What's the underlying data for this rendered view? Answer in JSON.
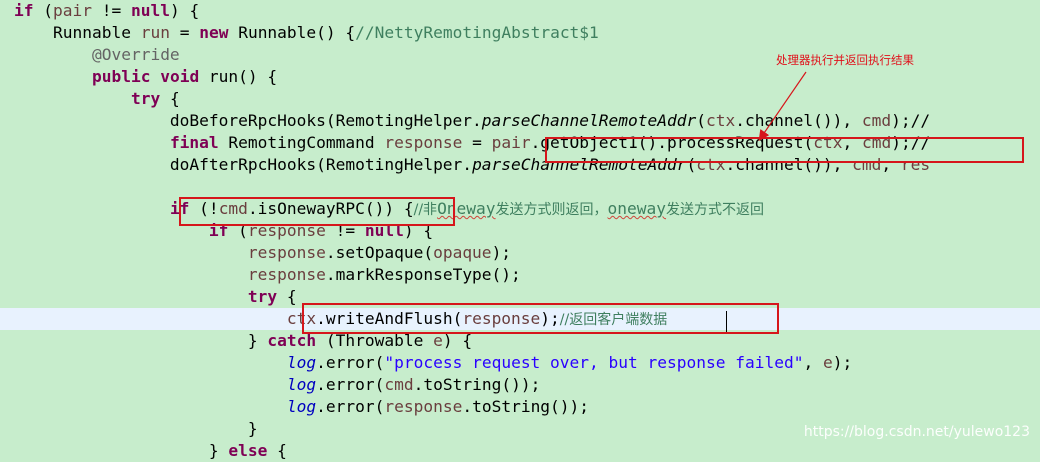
{
  "editor": {
    "lines": [
      {
        "segments": [
          {
            "t": "if",
            "c": "kw"
          },
          {
            "t": " ("
          },
          {
            "t": "pair",
            "c": "var"
          },
          {
            "t": " != "
          },
          {
            "t": "null",
            "c": "kw"
          },
          {
            "t": ") {"
          }
        ]
      },
      {
        "segments": [
          {
            "t": "    Runnable "
          },
          {
            "t": "run",
            "c": "var"
          },
          {
            "t": " = "
          },
          {
            "t": "new",
            "c": "kw"
          },
          {
            "t": " Runnable() {"
          },
          {
            "t": "//NettyRemotingAbstract$1",
            "c": "cm"
          }
        ]
      },
      {
        "segments": [
          {
            "t": "        "
          },
          {
            "t": "@Override",
            "c": "an"
          }
        ]
      },
      {
        "segments": [
          {
            "t": "        "
          },
          {
            "t": "public",
            "c": "kw"
          },
          {
            "t": " "
          },
          {
            "t": "void",
            "c": "kw"
          },
          {
            "t": " run() {"
          }
        ]
      },
      {
        "segments": [
          {
            "t": "            "
          },
          {
            "t": "try",
            "c": "kw"
          },
          {
            "t": " {"
          }
        ]
      },
      {
        "segments": [
          {
            "t": "                doBeforeRpcHooks(RemotingHelper."
          },
          {
            "t": "parseChannelRemoteAddr",
            "c": "it"
          },
          {
            "t": "("
          },
          {
            "t": "ctx",
            "c": "var"
          },
          {
            "t": ".channel()), "
          },
          {
            "t": "cmd",
            "c": "var"
          },
          {
            "t": ");//"
          }
        ]
      },
      {
        "segments": [
          {
            "t": "                "
          },
          {
            "t": "final",
            "c": "kw"
          },
          {
            "t": " RemotingCommand "
          },
          {
            "t": "response",
            "c": "var"
          },
          {
            "t": " = "
          },
          {
            "t": "pair",
            "c": "var"
          },
          {
            "t": ".getObject1().processRequest("
          },
          {
            "t": "ctx",
            "c": "var"
          },
          {
            "t": ", "
          },
          {
            "t": "cmd",
            "c": "var"
          },
          {
            "t": ");//"
          }
        ]
      },
      {
        "segments": [
          {
            "t": "                doAfterRpcHooks(RemotingHelper."
          },
          {
            "t": "parseChannelRemoteAddr",
            "c": "it"
          },
          {
            "t": "("
          },
          {
            "t": "ctx",
            "c": "var"
          },
          {
            "t": ".channel()), "
          },
          {
            "t": "cmd",
            "c": "var"
          },
          {
            "t": ", "
          },
          {
            "t": "res",
            "c": "var"
          }
        ]
      },
      {
        "segments": [
          {
            "t": ""
          }
        ]
      },
      {
        "segments": [
          {
            "t": "                "
          },
          {
            "t": "if",
            "c": "kw"
          },
          {
            "t": " (!"
          },
          {
            "t": "cmd",
            "c": "var"
          },
          {
            "t": ".isOnewayRPC()) {"
          },
          {
            "t": "//非",
            "c": "cm"
          },
          {
            "t": "Oneway",
            "c": "cm sq"
          },
          {
            "t": "发送方式则返回，",
            "c": "cm"
          },
          {
            "t": "oneway",
            "c": "cm sq"
          },
          {
            "t": "发送方式不返回",
            "c": "cm"
          }
        ]
      },
      {
        "segments": [
          {
            "t": "                    "
          },
          {
            "t": "if",
            "c": "kw"
          },
          {
            "t": " ("
          },
          {
            "t": "response",
            "c": "var"
          },
          {
            "t": " != "
          },
          {
            "t": "null",
            "c": "kw"
          },
          {
            "t": ") {"
          }
        ]
      },
      {
        "segments": [
          {
            "t": "                        "
          },
          {
            "t": "response",
            "c": "var"
          },
          {
            "t": ".setOpaque("
          },
          {
            "t": "opaque",
            "c": "var"
          },
          {
            "t": ");"
          }
        ]
      },
      {
        "segments": [
          {
            "t": "                        "
          },
          {
            "t": "response",
            "c": "var"
          },
          {
            "t": ".markResponseType();"
          }
        ]
      },
      {
        "segments": [
          {
            "t": "                        "
          },
          {
            "t": "try",
            "c": "kw"
          },
          {
            "t": " {"
          }
        ]
      },
      {
        "segments": [
          {
            "t": "                            "
          },
          {
            "t": "ctx",
            "c": "var"
          },
          {
            "t": ".writeAndFlush("
          },
          {
            "t": "response",
            "c": "var"
          },
          {
            "t": ");"
          },
          {
            "t": "//返回客户端数据",
            "c": "cm"
          }
        ],
        "highlight": true
      },
      {
        "segments": [
          {
            "t": "                        } "
          },
          {
            "t": "catch",
            "c": "kw"
          },
          {
            "t": " (Throwable "
          },
          {
            "t": "e",
            "c": "var"
          },
          {
            "t": ") {"
          }
        ]
      },
      {
        "segments": [
          {
            "t": "                            "
          },
          {
            "t": "log",
            "c": "fld"
          },
          {
            "t": ".error("
          },
          {
            "t": "\"process request over, but response failed\"",
            "c": "st"
          },
          {
            "t": ", "
          },
          {
            "t": "e",
            "c": "var"
          },
          {
            "t": ");"
          }
        ]
      },
      {
        "segments": [
          {
            "t": "                            "
          },
          {
            "t": "log",
            "c": "fld"
          },
          {
            "t": ".error("
          },
          {
            "t": "cmd",
            "c": "var"
          },
          {
            "t": ".toString());"
          }
        ]
      },
      {
        "segments": [
          {
            "t": "                            "
          },
          {
            "t": "log",
            "c": "fld"
          },
          {
            "t": ".error("
          },
          {
            "t": "response",
            "c": "var"
          },
          {
            "t": ".toString());"
          }
        ]
      },
      {
        "segments": [
          {
            "t": "                        }"
          }
        ]
      },
      {
        "segments": [
          {
            "t": "                    } "
          },
          {
            "t": "else",
            "c": "kw"
          },
          {
            "t": " {"
          }
        ]
      }
    ]
  },
  "annotation": {
    "callout_text": "处理器执行并返回执行结果",
    "color": "#e0111b"
  },
  "watermark": "https://blog.csdn.net/yulewo123",
  "colors": {
    "background": "#c7edcc",
    "current_line": "#e8f2fe",
    "keyword": "#7f0055",
    "local_variable": "#6a3e3e",
    "comment": "#3f7f5f",
    "annotation": "#646464",
    "string": "#2a00ff",
    "static_field": "#0000c0",
    "box_border": "#d6161b"
  }
}
